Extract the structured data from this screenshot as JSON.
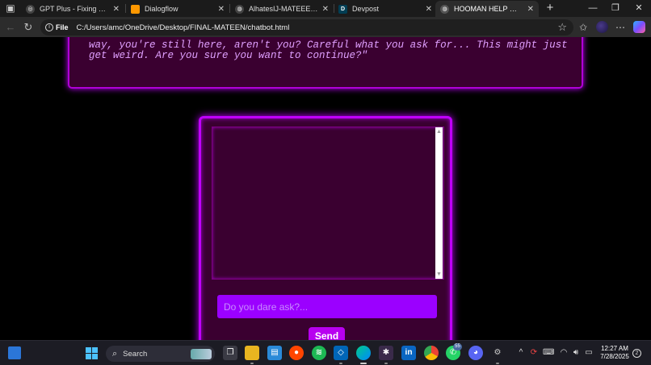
{
  "browser": {
    "tabs": [
      {
        "title": "GPT Plus - Fixing display issue",
        "favicon": "gpt-icon",
        "color": "#444444",
        "active": false
      },
      {
        "title": "Dialogflow",
        "favicon": "dialogflow-icon",
        "color": "#ff9800",
        "active": false
      },
      {
        "title": "AlhatesIJ-MATEEEN — my repo",
        "favicon": "github-icon",
        "color": "#444444",
        "active": false
      },
      {
        "title": "Devpost",
        "favicon": "devpost-icon",
        "color": "#003e54",
        "active": false,
        "letter": "D"
      },
      {
        "title": "HOOMAN HELP — Are you sure?",
        "favicon": "globe-icon",
        "color": "#555555",
        "active": true
      }
    ],
    "new_tab": "+",
    "window_controls": {
      "minimize": "—",
      "restore": "❐",
      "close": "✕"
    },
    "address": {
      "scheme": "File",
      "url": "C:/Users/amc/OneDrive/Desktop/FINAL-MATEEN/chatbot.html"
    }
  },
  "page": {
    "story_text": "way, you're still here, aren't you? Careful what you ask for... This might just get weird. Are you sure you want to continue?\"",
    "chat": {
      "input_placeholder": "Do you dare ask?...",
      "send_label": "Send"
    }
  },
  "taskbar": {
    "search_label": "Search",
    "badges": {
      "whatsapp": "55"
    },
    "clock": {
      "time": "12:27 AM",
      "date": "7/28/2025"
    },
    "notifications": "2"
  },
  "colors": {
    "accent": "#c000ff",
    "panel_bg": "#3a0030",
    "input_bg": "#9b00ff",
    "text_glow": "#e0a0ff"
  }
}
